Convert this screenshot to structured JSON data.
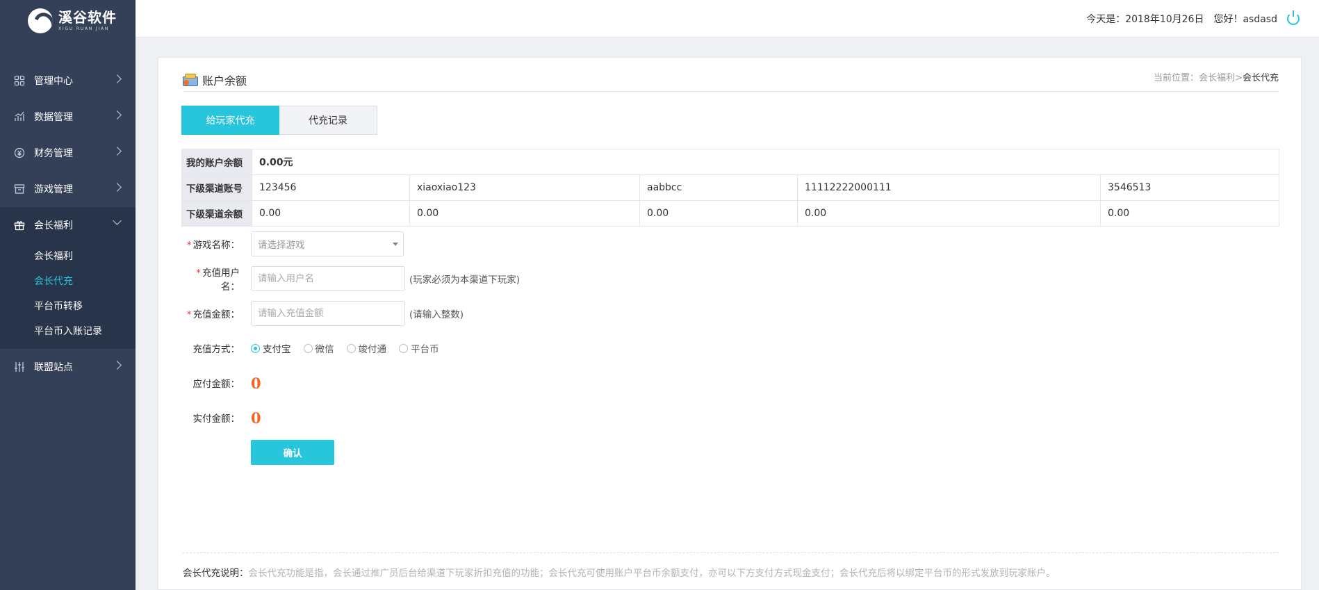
{
  "brand": {
    "name_cn": "溪谷软件",
    "name_en": "XIGU RUAN JIAN"
  },
  "header": {
    "date_text": "今天是：2018年10月26日",
    "greeting": "您好！asdasd"
  },
  "sidebar": {
    "items": [
      {
        "label": "管理中心",
        "icon": "grid-icon"
      },
      {
        "label": "数据管理",
        "icon": "chart-icon"
      },
      {
        "label": "财务管理",
        "icon": "finance-icon"
      },
      {
        "label": "游戏管理",
        "icon": "archive-icon"
      },
      {
        "label": "会长福利",
        "icon": "gift-icon",
        "open": true
      },
      {
        "label": "联盟站点",
        "icon": "sliders-icon"
      }
    ],
    "submenu": [
      {
        "label": "会长福利"
      },
      {
        "label": "会长代充",
        "active": true
      },
      {
        "label": "平台币转移"
      },
      {
        "label": "平台币入账记录"
      }
    ]
  },
  "page": {
    "title": "账户余额",
    "breadcrumb": {
      "prefix": "当前位置：",
      "parent": "会长福利",
      "sep": ">",
      "current": "会长代充"
    },
    "tabs": [
      {
        "label": "给玩家代充",
        "active": true
      },
      {
        "label": "代充记录"
      }
    ]
  },
  "account": {
    "balance_label": "我的账户余额",
    "balance_value": "0.00元",
    "sub_account_label": "下级渠道账号",
    "sub_balance_label": "下级渠道余额",
    "channels": [
      {
        "account": "123456",
        "balance": "0.00"
      },
      {
        "account": "xiaoxiao123",
        "balance": "0.00"
      },
      {
        "account": "aabbcc",
        "balance": "0.00"
      },
      {
        "account": "11112222000111",
        "balance": "0.00"
      },
      {
        "account": "3546513",
        "balance": "0.00"
      }
    ]
  },
  "form": {
    "required_mark": "*",
    "game": {
      "label": "游戏名称：",
      "placeholder": "请选择游戏"
    },
    "username": {
      "label": "充值用户名：",
      "placeholder": "请输入用户名",
      "hint": "(玩家必须为本渠道下玩家)"
    },
    "amount": {
      "label": "充值金额：",
      "placeholder": "请输入充值金额",
      "hint": "(请输入整数)"
    },
    "method": {
      "label": "充值方式：",
      "options": [
        "支付宝",
        "微信",
        "竣付通",
        "平台币"
      ],
      "selected": "支付宝"
    },
    "payable": {
      "label": "应付金额：",
      "value": "0"
    },
    "paid": {
      "label": "实付金额：",
      "value": "0"
    },
    "submit_label": "确认"
  },
  "footer_note": {
    "label": "会长代充说明：",
    "text": "会长代充功能是指，会长通过推广员后台给渠道下玩家折扣充值的功能；会长代充可使用账户平台币余额支付，亦可以下方支付方式现金支付；会长代充后将以绑定平台币的形式发放到玩家账户。"
  },
  "colors": {
    "accent": "#27c6dc",
    "sidebar": "#334057",
    "highlight": "#f26522"
  }
}
